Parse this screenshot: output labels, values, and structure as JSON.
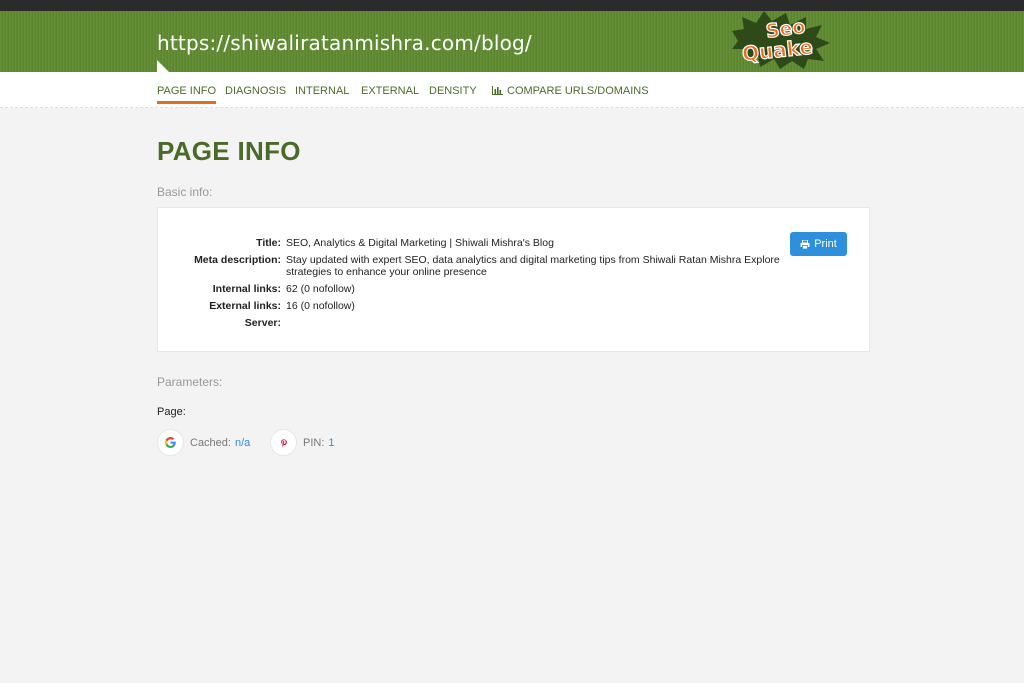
{
  "header": {
    "url": "https://shiwaliratanmishra.com/blog/",
    "logo_text": "SeoQuake"
  },
  "nav": {
    "items": [
      {
        "label": "PAGE INFO",
        "active": true
      },
      {
        "label": "DIAGNOSIS"
      },
      {
        "label": "INTERNAL"
      },
      {
        "label": "EXTERNAL"
      },
      {
        "label": "DENSITY"
      },
      {
        "label": "COMPARE URLS/DOMAINS",
        "icon": "bar-chart-icon"
      }
    ]
  },
  "main": {
    "title": "PAGE INFO",
    "basic_info_label": "Basic info:",
    "rows": [
      {
        "label": "Title:",
        "value": "SEO, Analytics & Digital Marketing | Shiwali Mishra's Blog"
      },
      {
        "label": "Meta description:",
        "value": "Stay updated with expert SEO, data analytics and digital marketing tips from Shiwali Ratan Mishra Explore strategies to enhance your online presence"
      },
      {
        "label": "Internal links:",
        "value": "62 (0 nofollow)"
      },
      {
        "label": "External links:",
        "value": "16 (0 nofollow)"
      },
      {
        "label": "Server:",
        "value": ""
      }
    ],
    "print_label": "Print",
    "parameters_label": "Parameters:",
    "page_label": "Page:",
    "params": [
      {
        "icon": "google-icon",
        "label": "Cached:",
        "value": "n/a"
      },
      {
        "icon": "pinterest-icon",
        "label": "PIN:",
        "value": "1"
      }
    ]
  },
  "colors": {
    "header_green": "#5e8a2e",
    "accent_orange": "#e46d1f",
    "link_blue": "#2e8fdc",
    "title_green": "#4a6a2a"
  }
}
